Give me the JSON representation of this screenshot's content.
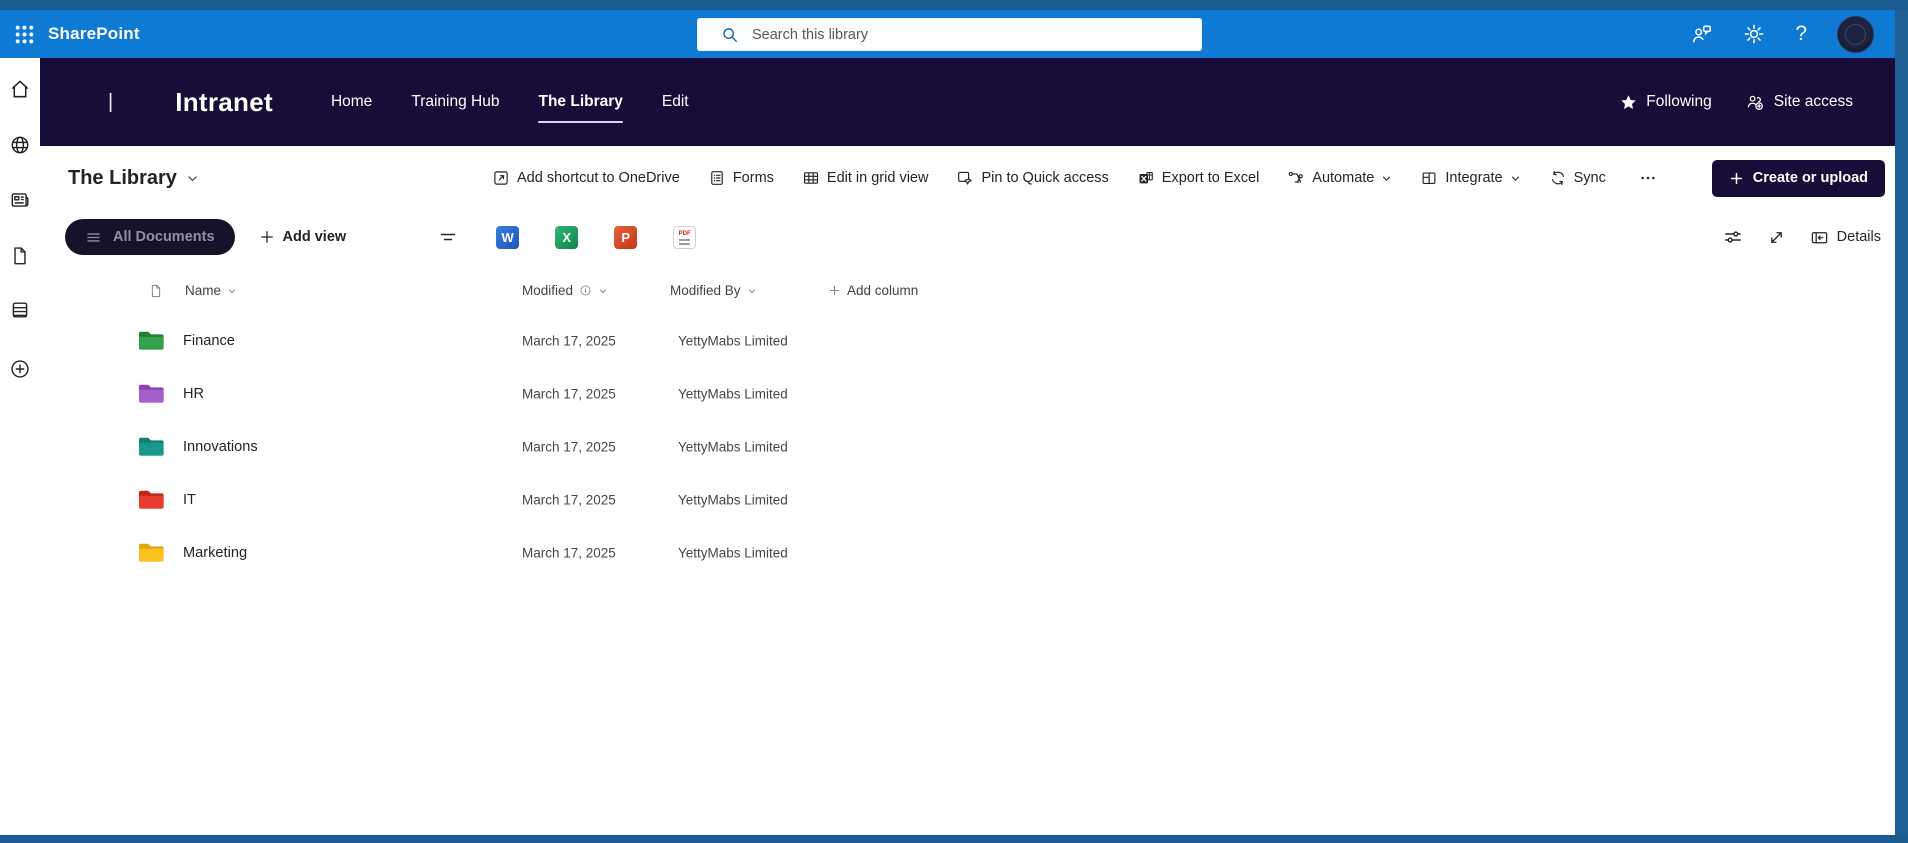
{
  "suite_bar": {
    "brand": "SharePoint",
    "search_placeholder": "Search this library"
  },
  "site_header": {
    "logo_mark": "|",
    "site_title": "Intranet",
    "nav": [
      {
        "label": "Home",
        "active": false
      },
      {
        "label": "Training Hub",
        "active": false
      },
      {
        "label": "The Library",
        "active": true
      },
      {
        "label": "Edit",
        "active": false
      }
    ],
    "following_label": "Following",
    "site_access_label": "Site access"
  },
  "command_bar": {
    "title": "The Library",
    "items": [
      {
        "label": "Add shortcut to OneDrive",
        "chevron": false
      },
      {
        "label": "Forms",
        "chevron": false
      },
      {
        "label": "Edit in grid view",
        "chevron": false
      },
      {
        "label": "Pin to Quick access",
        "chevron": false
      },
      {
        "label": "Export to Excel",
        "chevron": false
      },
      {
        "label": "Automate",
        "chevron": true
      },
      {
        "label": "Integrate",
        "chevron": true
      },
      {
        "label": "Sync",
        "chevron": false
      }
    ],
    "create_button_label": "Create or upload"
  },
  "view_bar": {
    "current_view": "All Documents",
    "add_view_label": "Add view",
    "details_label": "Details",
    "word_letter": "W",
    "excel_letter": "X",
    "powerpoint_letter": "P",
    "pdf_label": "PDF"
  },
  "table": {
    "columns": {
      "name": "Name",
      "modified": "Modified",
      "modified_by": "Modified By"
    },
    "add_column_label": "Add column",
    "rows": [
      {
        "name": "Finance",
        "modified": "March 17, 2025",
        "modified_by": "YettyMabs Limited",
        "folder_color": "#34a04a",
        "folder_dark": "#1f7f33"
      },
      {
        "name": "HR",
        "modified": "March 17, 2025",
        "modified_by": "YettyMabs Limited",
        "folder_color": "#a55fcb",
        "folder_dark": "#8a44b4"
      },
      {
        "name": "Innovations",
        "modified": "March 17, 2025",
        "modified_by": "YettyMabs Limited",
        "folder_color": "#1a998b",
        "folder_dark": "#0e7f71"
      },
      {
        "name": "IT",
        "modified": "March 17, 2025",
        "modified_by": "YettyMabs Limited",
        "folder_color": "#e93c2f",
        "folder_dark": "#c2271b"
      },
      {
        "name": "Marketing",
        "modified": "March 17, 2025",
        "modified_by": "YettyMabs Limited",
        "folder_color": "#fbc21f",
        "folder_dark": "#e0a60b"
      }
    ]
  },
  "colors": {
    "suite_blue": "#0e7ad4",
    "header_navy": "#170d38",
    "frame_blue": "#1a5c92"
  },
  "sidebar": {
    "icons": [
      "home",
      "globe",
      "news",
      "document",
      "list",
      "add"
    ]
  }
}
